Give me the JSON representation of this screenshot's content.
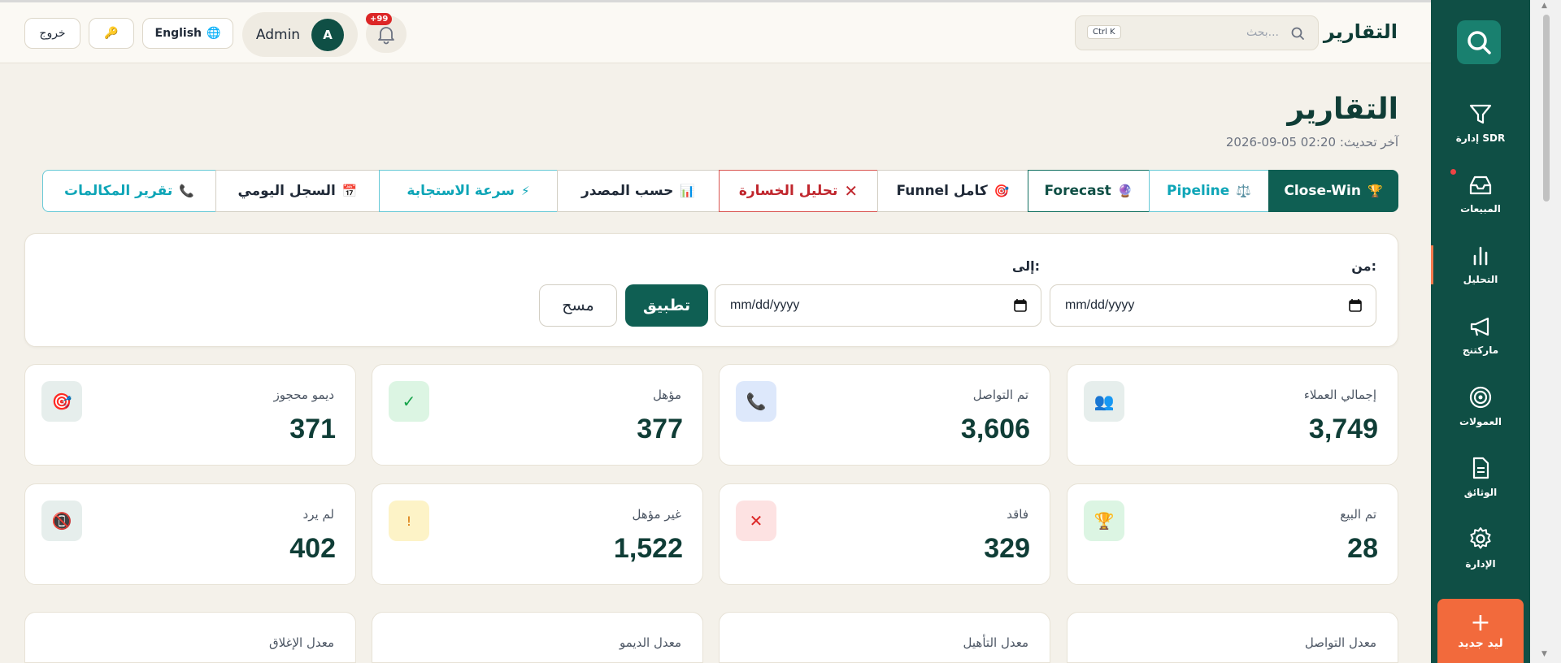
{
  "topbar": {
    "title": "التقارير",
    "search_placeholder": "بحث...",
    "search_shortcut": "Ctrl K",
    "notification_count": "+99",
    "user_name": "Admin",
    "user_initial": "A",
    "language_label": "English",
    "logout_label": "خروج"
  },
  "sidebar": {
    "items": [
      {
        "label": "إدارة SDR",
        "icon": "filter-icon"
      },
      {
        "label": "المبيعات",
        "icon": "inbox-icon"
      },
      {
        "label": "التحليل",
        "icon": "bar-chart-icon"
      },
      {
        "label": "ماركتنج",
        "icon": "megaphone-icon"
      },
      {
        "label": "العمولات",
        "icon": "target-icon"
      },
      {
        "label": "الوثائق",
        "icon": "document-icon"
      },
      {
        "label": "الإدارة",
        "icon": "gear-icon"
      }
    ],
    "new_lead_label": "ليد جديد"
  },
  "page": {
    "title": "التقارير",
    "updated_label": "آخر تحديث:",
    "updated_value": "2026-09-05 02:20"
  },
  "tabs": [
    {
      "label": "Close-Win",
      "icon": "🏆"
    },
    {
      "label": "Pipeline",
      "icon": "⚖️"
    },
    {
      "label": "Forecast",
      "icon": "🔮"
    },
    {
      "label": "Funnel كامل",
      "icon": "🎯"
    },
    {
      "label": "تحليل الخسارة",
      "icon": "✕"
    },
    {
      "label": "حسب المصدر",
      "icon": "📊"
    },
    {
      "label": "سرعة الاستجابة",
      "icon": "⚡"
    },
    {
      "label": "السجل اليومي",
      "icon": "📅"
    },
    {
      "label": "تقرير المكالمات",
      "icon": "📞"
    }
  ],
  "filter": {
    "from_label": "من:",
    "to_label": "إلى:",
    "from_value": "mm/dd/yyyy",
    "to_value": "mm/dd/yyyy",
    "apply_label": "تطبيق",
    "clear_label": "مسح"
  },
  "stats": [
    {
      "label": "إجمالي العملاء",
      "value": "3,749",
      "icon": "👥"
    },
    {
      "label": "تم التواصل",
      "value": "3,606",
      "icon": "📞"
    },
    {
      "label": "مؤهل",
      "value": "377",
      "icon": "✓"
    },
    {
      "label": "ديمو محجوز",
      "value": "371",
      "icon": "🎯"
    },
    {
      "label": "تم البيع",
      "value": "28",
      "icon": "🏆"
    },
    {
      "label": "فاقد",
      "value": "329",
      "icon": "✕"
    },
    {
      "label": "غير مؤهل",
      "value": "1,522",
      "icon": "!"
    },
    {
      "label": "لم يرد",
      "value": "402",
      "icon": "📵"
    }
  ],
  "rates": [
    {
      "label": "معدل التواصل"
    },
    {
      "label": "معدل التأهيل"
    },
    {
      "label": "معدل الديمو"
    },
    {
      "label": "معدل الإغلاق"
    }
  ],
  "colors": {
    "primary": "#0f5f53",
    "sidebar": "#0f4f45",
    "accent": "#f26a3c",
    "background": "#f4f1ea"
  }
}
